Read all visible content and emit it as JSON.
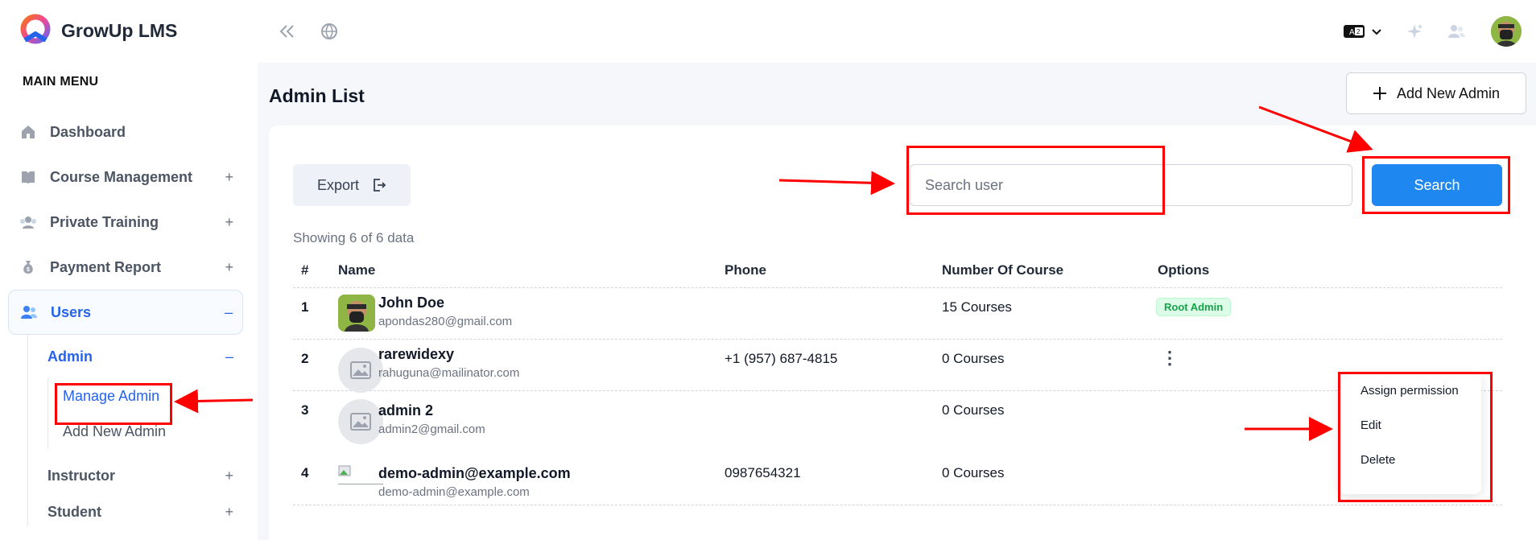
{
  "app": {
    "name": "GrowUp LMS"
  },
  "sidebar": {
    "menu_title": "MAIN MENU",
    "items": [
      {
        "label": "Dashboard",
        "icon": "home-icon",
        "toggle": ""
      },
      {
        "label": "Course Management",
        "icon": "book-icon",
        "toggle": "+"
      },
      {
        "label": "Private Training",
        "icon": "group-icon",
        "toggle": "+"
      },
      {
        "label": "Payment Report",
        "icon": "money-bag-icon",
        "toggle": "+"
      },
      {
        "label": "Users",
        "icon": "users-icon",
        "toggle": "–"
      }
    ],
    "users_sub": [
      {
        "label": "Admin",
        "toggle": "–"
      },
      {
        "label": "Instructor",
        "toggle": "+"
      },
      {
        "label": "Student",
        "toggle": "+"
      }
    ],
    "admin_sub": [
      {
        "label": "Manage Admin"
      },
      {
        "label": "Add New Admin"
      }
    ]
  },
  "topbar": {
    "collapse_icon": "double-chevron-left-icon",
    "globe_icon": "globe-icon",
    "language_icon": "translate-icon",
    "sparkle_icon": "sparkle-icon",
    "people_icon": "users-icon"
  },
  "main": {
    "title": "Admin List",
    "add_button": "Add New Admin",
    "export_button": "Export",
    "search": {
      "placeholder": "Search user",
      "button": "Search"
    },
    "showing": "Showing 6 of 6 data",
    "columns": [
      "#",
      "Name",
      "Phone",
      "Number Of Course",
      "Options"
    ],
    "rows": [
      {
        "num": "1",
        "name": "John Doe",
        "email": "apondas280@gmail.com",
        "phone": "",
        "courses": "15 Courses",
        "option": "Root Admin"
      },
      {
        "num": "2",
        "name": "rarewidexy",
        "email": "rahuguna@mailinator.com",
        "phone": "+1 (957) 687-4815",
        "courses": "0 Courses",
        "option": "⋮"
      },
      {
        "num": "3",
        "name": "admin 2",
        "email": "admin2@gmail.com",
        "phone": "",
        "courses": "0 Courses",
        "option": ""
      },
      {
        "num": "4",
        "name": "demo-admin@example.com",
        "email": "demo-admin@example.com",
        "phone": "0987654321",
        "courses": "0 Courses",
        "option": ""
      }
    ],
    "dropdown": [
      "Assign permission",
      "Edit",
      "Delete"
    ]
  },
  "colors": {
    "accent": "#1e88f0",
    "annotation": "#ff0000",
    "badge_bg": "#dcfce7",
    "badge_text": "#16a34a"
  }
}
